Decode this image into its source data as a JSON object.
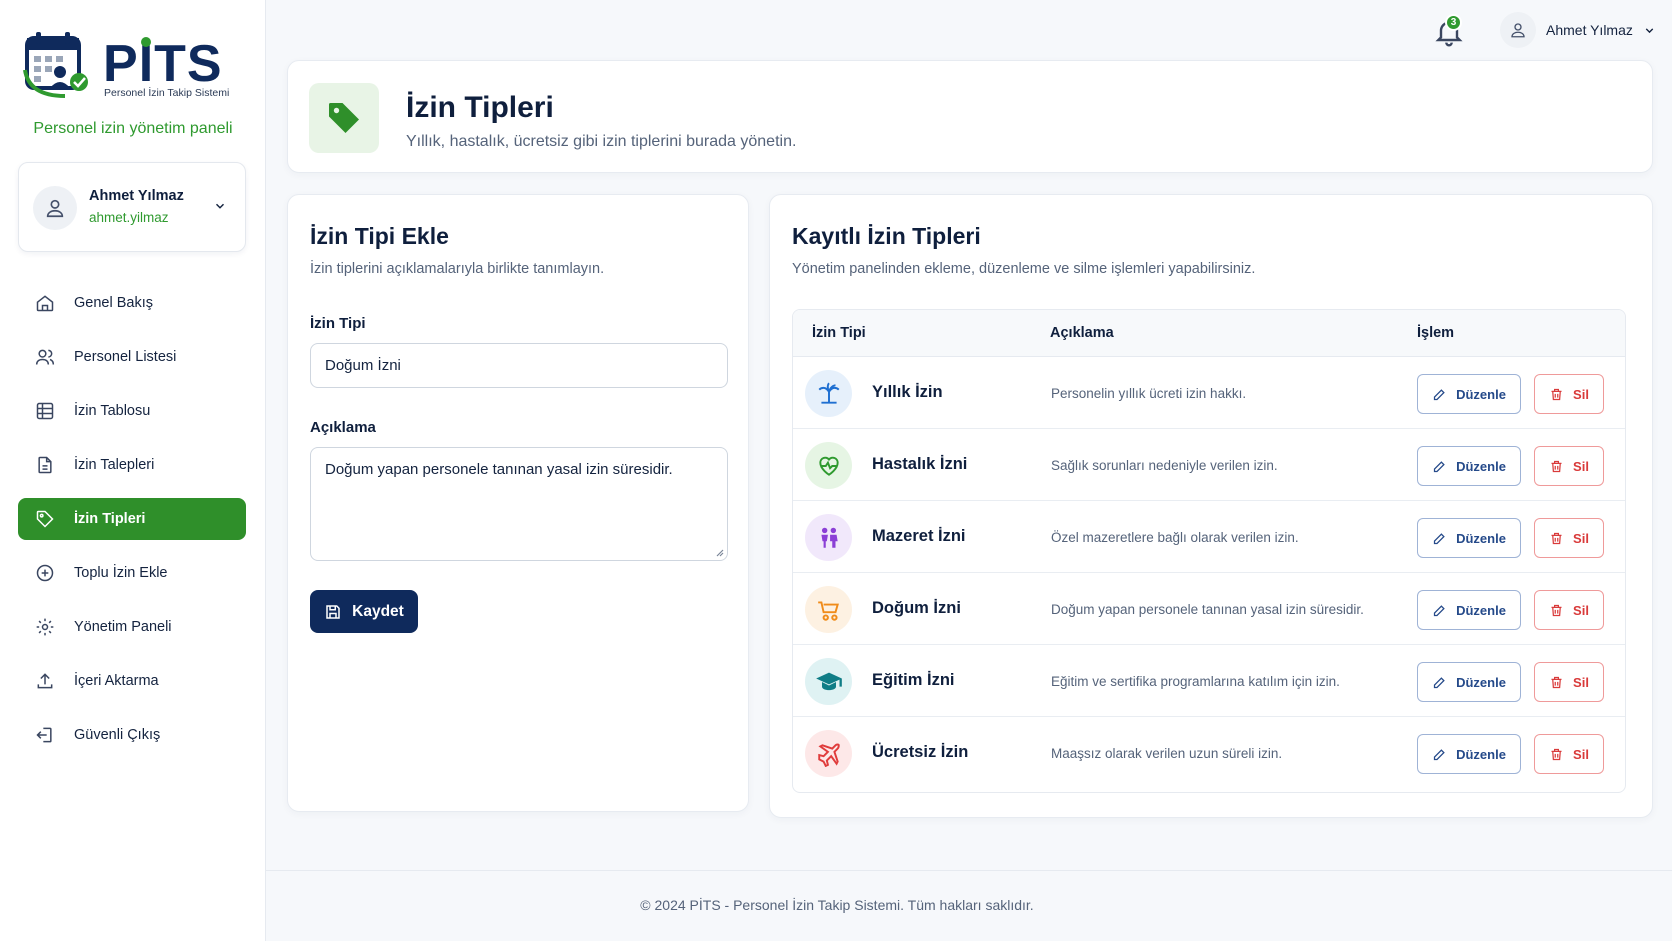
{
  "brand": {
    "name": "PİTS",
    "subtitle": "Personel İzin Takip Sistemi",
    "tagline": "Personel izin yönetim paneli"
  },
  "user": {
    "name": "Ahmet Yılmaz",
    "handle": "ahmet.yilmaz"
  },
  "nav": [
    {
      "label": "Genel Bakış",
      "icon": "home-icon",
      "active": false
    },
    {
      "label": "Personel Listesi",
      "icon": "users-icon",
      "active": false
    },
    {
      "label": "İzin Tablosu",
      "icon": "table-icon",
      "active": false
    },
    {
      "label": "İzin Talepleri",
      "icon": "file-icon",
      "active": false
    },
    {
      "label": "İzin Tipleri",
      "icon": "tag-icon",
      "active": true
    },
    {
      "label": "Toplu İzin Ekle",
      "icon": "plus-circle-icon",
      "active": false
    },
    {
      "label": "Yönetim Paneli",
      "icon": "gear-icon",
      "active": false
    },
    {
      "label": "İçeri Aktarma",
      "icon": "upload-icon",
      "active": false
    },
    {
      "label": "Güvenli Çıkış",
      "icon": "logout-icon",
      "active": false
    }
  ],
  "topbar": {
    "notification_count": "3",
    "user_name": "Ahmet Yılmaz"
  },
  "header": {
    "title": "İzin Tipleri",
    "subtitle": "Yıllık, hastalık, ücretsiz gibi izin tiplerini burada yönetin."
  },
  "form": {
    "title": "İzin Tipi Ekle",
    "subtitle": "İzin tiplerini açıklamalarıyla birlikte tanımlayın.",
    "type_label": "İzin Tipi",
    "type_value": "Doğum İzni",
    "desc_label": "Açıklama",
    "desc_value": "Doğum yapan personele tanınan yasal izin süresidir.",
    "save_label": "Kaydet"
  },
  "list": {
    "title": "Kayıtlı İzin Tipleri",
    "subtitle": "Yönetim panelinden ekleme, düzenleme ve silme işlemleri yapabilirsiniz.",
    "columns": [
      "İzin Tipi",
      "Açıklama",
      "İşlem"
    ],
    "edit_label": "Düzenle",
    "delete_label": "Sil",
    "rows": [
      {
        "name": "Yıllık İzin",
        "desc": "Personelin yıllık ücreti izin hakkı.",
        "icon": "palm-tree-icon",
        "color": "#1f6fd1",
        "bg": "#e6f0fb"
      },
      {
        "name": "Hastalık İzni",
        "desc": "Sağlık sorunları nedeniyle verilen izin.",
        "icon": "heart-pulse-icon",
        "color": "#2f9a2f",
        "bg": "#e6f5e4"
      },
      {
        "name": "Mazeret İzni",
        "desc": "Özel mazeretlere bağlı olarak verilen izin.",
        "icon": "people-icon",
        "color": "#8b3fd6",
        "bg": "#f1e8fb"
      },
      {
        "name": "Doğum İzni",
        "desc": "Doğum yapan personele tanınan yasal izin süresidir.",
        "icon": "stroller-icon",
        "color": "#f08c1a",
        "bg": "#fdf1e2"
      },
      {
        "name": "Eğitim İzni",
        "desc": "Eğitim ve sertifika programlarına katılım için izin.",
        "icon": "graduation-cap-icon",
        "color": "#0f7d86",
        "bg": "#dff2f3"
      },
      {
        "name": "Ücretsiz İzin",
        "desc": "Maaşsız olarak verilen uzun süreli izin.",
        "icon": "plane-icon",
        "color": "#e03c3c",
        "bg": "#fde8e8"
      }
    ]
  },
  "footer": {
    "text": "© 2024 PİTS - Personel İzin Takip Sistemi. Tüm hakları saklıdır."
  }
}
